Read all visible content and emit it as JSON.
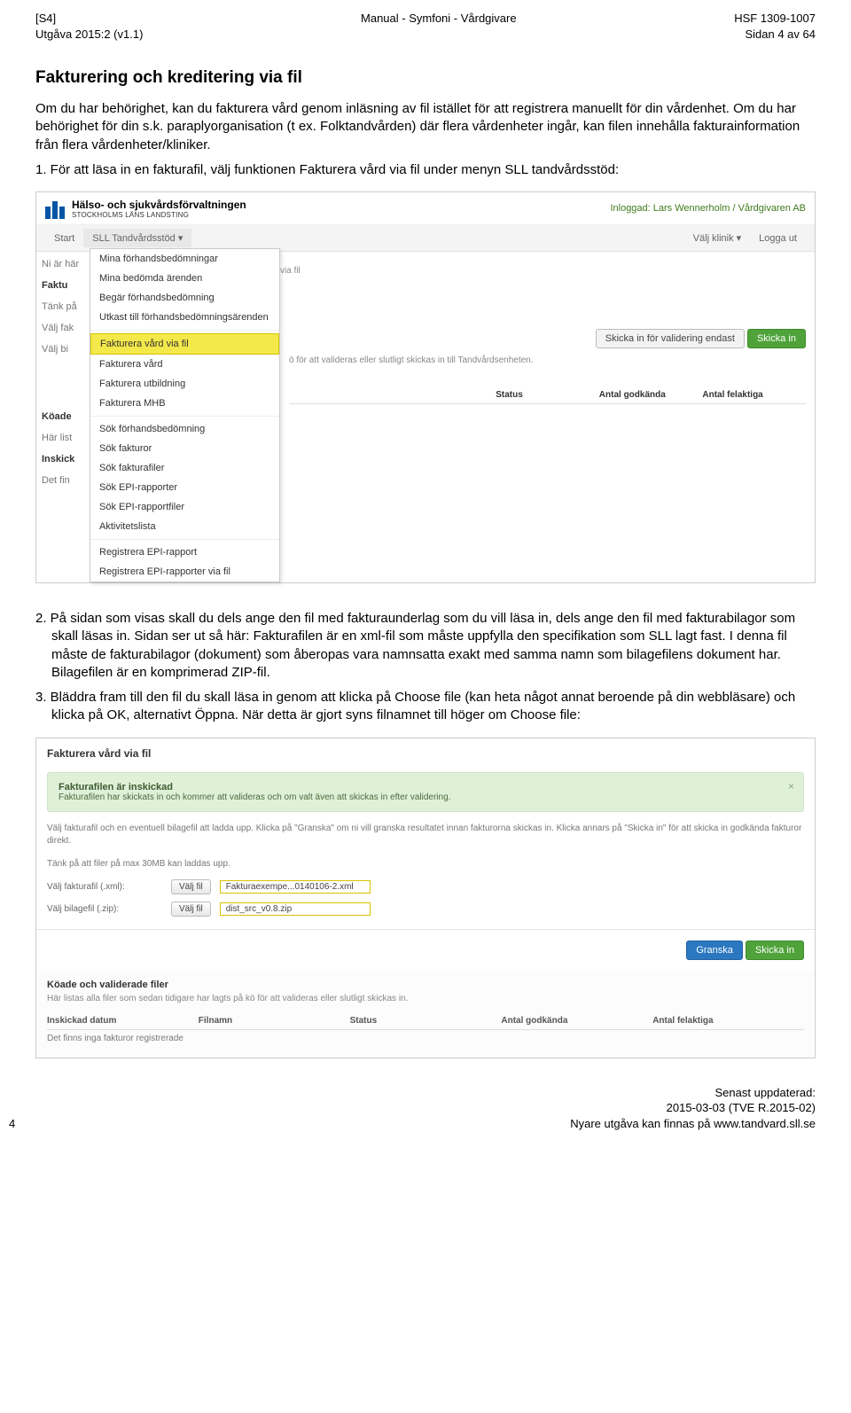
{
  "header": {
    "left_line1": "[S4]",
    "left_line2": "Utgåva 2015:2 (v1.1)",
    "center_line1": "Manual - Symfoni - Vårdgivare",
    "right_line1": "HSF 1309-1007",
    "right_line2": "Sidan 4 av 64"
  },
  "section_title": "Fakturering och kreditering via fil",
  "intro_p1": "Om du har behörighet, kan du fakturera vård genom inläsning av fil istället för att registrera manuellt för din vårdenhet. Om du har behörighet för din s.k. paraplyorganisation (t ex. Folktandvården) där flera vårdenheter ingår, kan filen innehålla fakturainformation från flera vårdenheter/kliniker.",
  "step1": "1. För att läsa in en fakturafil, välj funktionen Fakturera vård via fil under menyn SLL tandvårdsstöd:",
  "step2": "2. På sidan som visas skall du dels ange den fil med fakturaunderlag som du vill läsa in, dels ange den fil med fakturabilagor som skall läsas in. Sidan ser ut så här: Fakturafilen är en xml-fil som måste uppfylla den specifikation som SLL lagt fast. I denna fil måste de fakturabilagor (dokument) som åberopas vara namnsatta exakt med samma namn som bilagefilens dokument har. Bilagefilen är en komprimerad ZIP-fil.",
  "step3": "3. Bläddra fram till den fil du skall läsa in genom att klicka på Choose file (kan heta något annat beroende på din webbläsare) och klicka på OK, alternativt Öppna. När detta är gjort syns filnamnet till höger om Choose file:",
  "shot1": {
    "org_name": "Hälso- och sjukvårdsförvaltningen",
    "org_sub": "STOCKHOLMS LÄNS LANDSTING",
    "logged_in_label": "Inloggad:",
    "logged_in_user": "Lars Wennerholm / Vårdgivaren AB",
    "nav": {
      "start": "Start",
      "sll_menu": "SLL Tandvårdsstöd ▾",
      "valj_klinik": "Välj klinik ▾",
      "logga_ut": "Logga ut"
    },
    "left": {
      "ni_ar": "Ni är här",
      "faktu": "Faktu",
      "tank_pa": "Tänk på",
      "valj_fak": "Välj fak",
      "valj_bi": "Välj bi",
      "koade": "Köade",
      "har_list": "Här list",
      "inskick": "Inskick",
      "det_fin": "Det fin"
    },
    "menu": {
      "items": [
        "Mina förhandsbedömningar",
        "Mina bedömda ärenden",
        "Begär förhandsbedömning",
        "Utkast till förhandsbedömningsärenden",
        "Fakturera vård via fil",
        "Fakturera vård",
        "Fakturera utbildning",
        "Fakturera MHB",
        "Sök förhandsbedömning",
        "Sök fakturor",
        "Sök fakturafiler",
        "Sök EPI-rapporter",
        "Sök EPI-rapportfiler",
        "Aktivitetslista",
        "Registrera EPI-rapport",
        "Registrera EPI-rapporter via fil"
      ]
    },
    "right": {
      "crumb": "via fil",
      "btn_validate": "Skicka in för validering endast",
      "btn_send": "Skicka in",
      "hint_text": "ö för att valideras eller slutligt skickas in till Tandvårdsenheten.",
      "col_status": "Status",
      "col_antal_god": "Antal godkända",
      "col_antal_fel": "Antal felaktiga"
    }
  },
  "shot2": {
    "title": "Fakturera vård via fil",
    "success_title": "Fakturafilen är inskickad",
    "success_body": "Fakturafilen har skickats in och kommer att valideras och om valt även att skickas in efter validering.",
    "info_line1": "Välj fakturafil och en eventuell bilagefil att ladda upp. Klicka på \"Granska\" om ni vill granska resultatet innan fakturorna skickas in. Klicka annars på \"Skicka in\" för att skicka in godkända fakturor direkt.",
    "info_line2": "Tänk på att filer på max 30MB kan laddas upp.",
    "row_xml_label": "Välj fakturafil (.xml):",
    "row_zip_label": "Välj bilagefil (.zip):",
    "btn_choose": "Välj fil",
    "xml_filename": "Fakturaexempe...0140106-2.xml",
    "zip_filename": "dist_src_v0.8.zip",
    "btn_granska": "Granska",
    "btn_skicka": "Skicka in",
    "queued_title": "Köade och validerade filer",
    "queued_desc": "Här listas alla filer som sedan tidigare har lagts på kö för att valideras eller slutligt skickas in.",
    "qh1": "Inskickad datum",
    "qh2": "Filnamn",
    "qh3": "Status",
    "qh4": "Antal godkända",
    "qh5": "Antal felaktiga",
    "empty": "Det finns inga fakturor registrerade"
  },
  "footer": {
    "page_number": "4",
    "line1": "Senast uppdaterad:",
    "line2": "2015-03-03 (TVE R.2015-02)",
    "line3": "Nyare utgåva kan finnas på www.tandvard.sll.se"
  }
}
